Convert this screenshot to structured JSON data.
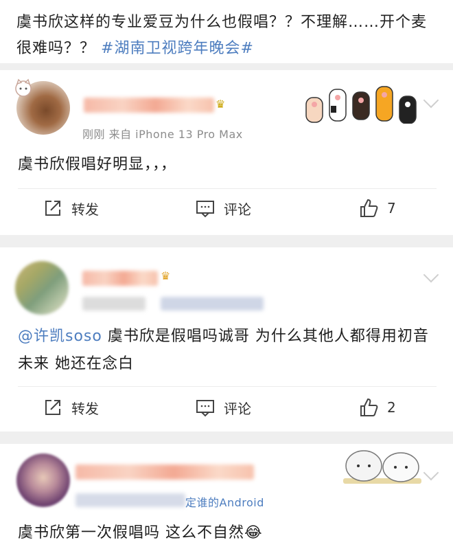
{
  "headline": {
    "text": "虞书欣这样的专业爱豆为什么也假唱？？不理解……开个麦很难吗？？",
    "topic": "#湖南卫视跨年晚会#"
  },
  "comments": [
    {
      "meta": "刚刚  来自 iPhone 13 Pro Max",
      "text": "虞书欣假唱好明显，，，",
      "actions": {
        "repost": "转发",
        "comment": "评论",
        "like_count": "7"
      }
    },
    {
      "meta": "",
      "mention": "@许凯soso",
      "text": " 虞书欣是假唱吗诚哥   为什么其他人都得用初音未来  她还在念白",
      "actions": {
        "repost": "转发",
        "comment": "评论",
        "like_count": "2"
      }
    },
    {
      "meta": "定谁的Android",
      "text": "虞书欣第一次假唱吗 这么不自然😂"
    }
  ],
  "colors": {
    "link": "#4d7dbf",
    "background": "#f2f2f2"
  },
  "icons": [
    "repost-icon",
    "comment-icon",
    "like-icon",
    "chevron-down-icon"
  ]
}
